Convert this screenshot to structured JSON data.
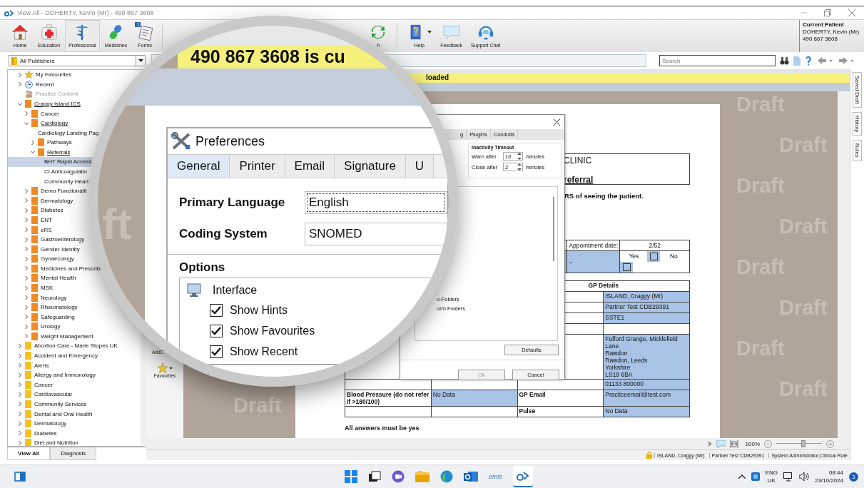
{
  "window": {
    "title": "View All  -  DOHERTY, Kevin (Mr) - 490 867 3608"
  },
  "toolbar": {
    "left_buttons": [
      {
        "label": "Home",
        "selected": false
      },
      {
        "label": "Education",
        "selected": false
      },
      {
        "label": "Professional",
        "selected": true
      },
      {
        "label": "Medicines",
        "selected": false
      },
      {
        "label": "Forms",
        "selected": false,
        "badge": "1"
      }
    ],
    "right_buttons": [
      {
        "label": "h",
        "dropdown": false
      },
      {
        "label": "Help",
        "dropdown": true
      },
      {
        "label": "Feedback",
        "dropdown": false
      },
      {
        "label": "Support Chat",
        "dropdown": false
      }
    ]
  },
  "current_patient": {
    "heading": "Current Patient",
    "name": "DOHERTY, Kevin (Mr)",
    "number": "490 867 3608"
  },
  "publisher_select": {
    "value": "All Publishers"
  },
  "search": {
    "placeholder": "Search"
  },
  "sidebar": {
    "tree": [
      {
        "label": "My Favourites",
        "kind": "favourites",
        "expanded": false,
        "selected": false
      },
      {
        "label": "Recent",
        "kind": "recent",
        "expanded": false,
        "selected": false
      },
      {
        "label": "Practice Content",
        "kind": "practice",
        "disabled": true,
        "selected": false
      },
      {
        "label": "Craggy Island ICS",
        "kind": "folder",
        "color": "#f08a24",
        "expanded": true,
        "selected": false,
        "children": [
          {
            "label": "Cancer",
            "kind": "folder",
            "color": "#f08a24",
            "expanded": false,
            "selected": false
          },
          {
            "label": "Cardiology",
            "kind": "folder",
            "color": "#f08a24",
            "expanded": true,
            "selected": false,
            "children": [
              {
                "label": "Cardiology Landing Pag",
                "selected": false
              },
              {
                "label": "Pathways",
                "kind": "folder",
                "color": "#f08a24",
                "expanded": false,
                "selected": false
              },
              {
                "label": "Referrals",
                "kind": "folder",
                "color": "#f08a24",
                "expanded": true,
                "selected": false,
                "children": [
                  {
                    "label": "BHT Rapid Access",
                    "selected": true
                  },
                  {
                    "label": "CI Anticoagulatio",
                    "selected": false
                  },
                  {
                    "label": "Community Heart",
                    "selected": false
                  }
                ]
              }
            ]
          },
          {
            "label": "Demo Functionalit",
            "kind": "folder",
            "color": "#f08a24",
            "expanded": false,
            "selected": false
          },
          {
            "label": "Dermatology",
            "kind": "folder",
            "color": "#f08a24",
            "expanded": false,
            "selected": false
          },
          {
            "label": "Diabetes",
            "kind": "folder",
            "color": "#f08a24",
            "expanded": false,
            "selected": false
          },
          {
            "label": "ENT",
            "kind": "folder",
            "color": "#f08a24",
            "expanded": false,
            "selected": false
          },
          {
            "label": "eRS",
            "kind": "folder",
            "color": "#f08a24",
            "expanded": false,
            "selected": false
          },
          {
            "label": "Gastroenterology",
            "kind": "folder",
            "color": "#f08a24",
            "expanded": false,
            "selected": false
          },
          {
            "label": "Gender Identity",
            "kind": "folder",
            "color": "#f08a24",
            "expanded": false,
            "selected": false
          },
          {
            "label": "Gynaecology",
            "kind": "folder",
            "color": "#f08a24",
            "expanded": false,
            "selected": false
          },
          {
            "label": "Medicines and Prescribi",
            "kind": "folder",
            "color": "#f08a24",
            "expanded": false,
            "selected": false
          },
          {
            "label": "Mental Health",
            "kind": "folder",
            "color": "#f08a24",
            "expanded": false,
            "selected": false
          },
          {
            "label": "MSK",
            "kind": "folder",
            "color": "#f08a24",
            "expanded": false,
            "selected": false
          },
          {
            "label": "Neurology",
            "kind": "folder",
            "color": "#f08a24",
            "expanded": false,
            "selected": false
          },
          {
            "label": "Rheumatology",
            "kind": "folder",
            "color": "#f08a24",
            "expanded": false,
            "selected": false
          },
          {
            "label": "Safeguarding",
            "kind": "folder",
            "color": "#f08a24",
            "expanded": false,
            "selected": false
          },
          {
            "label": "Urology",
            "kind": "folder",
            "color": "#f08a24",
            "expanded": false,
            "selected": false
          },
          {
            "label": "Weight Management",
            "kind": "folder",
            "color": "#f08a24",
            "expanded": false,
            "selected": false
          }
        ]
      },
      {
        "label": "Abortion Care - Marie Stopes UK",
        "kind": "folder",
        "color": "#f5c21b",
        "expanded": false,
        "selected": false
      },
      {
        "label": "Accident and Emergency",
        "kind": "folder",
        "color": "#f5c21b",
        "expanded": false,
        "selected": false
      },
      {
        "label": "Alerts",
        "kind": "folder",
        "color": "#f5c21b",
        "expanded": false,
        "selected": false
      },
      {
        "label": "Allergy and Immunology",
        "kind": "folder",
        "color": "#f5c21b",
        "expanded": false,
        "selected": false
      },
      {
        "label": "Cancer",
        "kind": "folder",
        "color": "#f5c21b",
        "expanded": false,
        "selected": false
      },
      {
        "label": "Cardiovascular",
        "kind": "folder",
        "color": "#f5c21b",
        "expanded": false,
        "selected": false
      },
      {
        "label": "Community Services",
        "kind": "folder",
        "color": "#f5c21b",
        "expanded": false,
        "selected": false
      },
      {
        "label": "Dental and Oral Health",
        "kind": "folder",
        "color": "#f5c21b",
        "expanded": false,
        "selected": false
      },
      {
        "label": "Dermatology",
        "kind": "folder",
        "color": "#f5c21b",
        "expanded": false,
        "selected": false
      },
      {
        "label": "Diabetes",
        "kind": "folder",
        "color": "#f5c21b",
        "expanded": false,
        "selected": false
      },
      {
        "label": "Diet and Nutrition",
        "kind": "folder",
        "color": "#f5c21b",
        "expanded": false,
        "selected": false
      }
    ],
    "tabs": [
      {
        "label": "View All",
        "selected": true
      },
      {
        "label": "Diagnosis",
        "selected": false
      }
    ]
  },
  "banner": {
    "text": "loaded"
  },
  "side_strip": {
    "add_label": "AddC",
    "favourites_label": "Favourites"
  },
  "watermarks_left": [
    "Draft"
  ],
  "watermarks_right": [
    "Draft",
    "Draft",
    "Draft",
    "Draft",
    "Draft",
    "Draft",
    "Draft",
    "Draft"
  ],
  "document": {
    "header": [
      "CLINIC",
      "referral"
    ],
    "notice": "RS of seeing the patient.",
    "appointment": {
      "label": "Appointment date:",
      "value": "2/52",
      "yes": "Yes",
      "no": "No",
      "yes_checked": false,
      "no_checked": false
    },
    "gp_table": {
      "heading": "GP Details",
      "rows": [
        {
          "cells": [
            {
              "text": "",
              "field": false
            },
            {
              "text": "ISLAND, Craggy (Mr)",
              "field": true
            }
          ]
        },
        {
          "cells": [
            {
              "text": "",
              "field": false
            },
            {
              "text": "Partner Test CDB29391",
              "field": true
            }
          ]
        },
        {
          "cells": [
            {
              "text": "",
              "field": false
            },
            {
              "text": "SSTE1",
              "field": true
            }
          ]
        },
        {
          "cells": [
            {
              "text": "",
              "field": false
            },
            {
              "text": "",
              "field": false
            }
          ]
        },
        {
          "cells": [
            {
              "text": "",
              "field": false
            },
            {
              "text": "Fulford Grange, Micklefield\nLane\nRawdon\nRawdon, Leeds\nYorkshire\nLS19 6BA",
              "field": true
            }
          ]
        },
        {
          "cells": [
            {
              "text": "",
              "field": false
            },
            {
              "text": "01133 800000",
              "field": true
            }
          ]
        },
        {
          "cells": [
            {
              "text": "Blood Pressure (do not refer if >180/100)",
              "field": false
            },
            {
              "text": "No Data",
              "field": true
            },
            {
              "text": "GP Email",
              "field": false
            },
            {
              "text": "Practiceemail@test.com",
              "field": true
            }
          ]
        },
        {
          "cells": [
            {
              "text": "",
              "field": false
            },
            {
              "text": "",
              "field": false
            },
            {
              "text": "Pulse",
              "field": false
            },
            {
              "text": "No Data",
              "field": true
            }
          ]
        }
      ]
    },
    "footer_text": "All answers must be yes"
  },
  "right_tabs": [
    "Saved Draft",
    "History",
    "Notes"
  ],
  "zoom": {
    "label": "100%",
    "level": 0.6
  },
  "status_bar": [
    "ISLAND, Craggy (Mr)",
    "Partner Test CDB29391",
    "System Administrator,Clinical Role"
  ],
  "dialog": {
    "tabs": [
      "g",
      "Plugins",
      "Conduits"
    ],
    "timeout": {
      "title": "Inactivity Timeout",
      "rows": [
        {
          "label": "Warn after",
          "value": "10",
          "unit": "minutes"
        },
        {
          "label": "Close after",
          "value": "2",
          "unit": "minutes"
        }
      ]
    },
    "list_items": [
      "o-Folders",
      "orm Folders"
    ],
    "defaults": "Defaults",
    "ok": {
      "label": "Ok",
      "disabled": true
    },
    "cancel": "Cancel"
  },
  "magnifier": {
    "banner": "490 867 3608 is cu",
    "watermark": "ft",
    "title": "Preferences",
    "tabs": [
      {
        "label": "General",
        "selected": true
      },
      {
        "label": "Printer",
        "selected": false
      },
      {
        "label": "Email",
        "selected": false
      },
      {
        "label": "Signature",
        "selected": false
      },
      {
        "label": "U",
        "selected": false
      }
    ],
    "fields": [
      {
        "label": "Primary Language",
        "value": "English",
        "focused": true
      },
      {
        "label": "Coding System",
        "value": "SNOMED",
        "focused": false
      }
    ],
    "options_heading": "Options",
    "options_group": "Interface",
    "options": [
      {
        "label": "Show Hints",
        "checked": true
      },
      {
        "label": "Show Favourites",
        "checked": true
      },
      {
        "label": "Show Recent",
        "checked": true
      }
    ]
  },
  "taskbar": {
    "emis_label": "emis",
    "language": "ENG",
    "region": "UK",
    "time": "08:44",
    "date": "23/10/2024",
    "badge": "3"
  }
}
